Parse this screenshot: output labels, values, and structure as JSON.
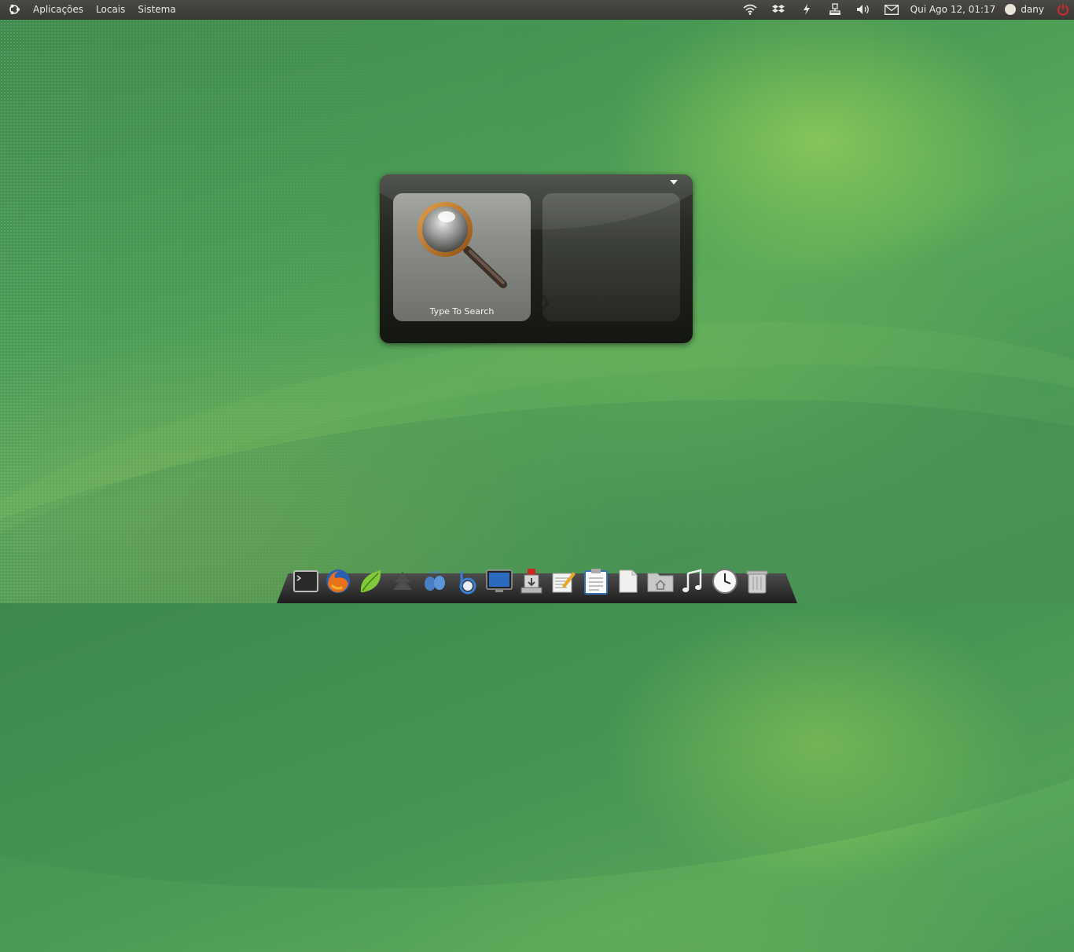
{
  "top_panel": {
    "menus": [
      "Aplicações",
      "Locais",
      "Sistema"
    ],
    "tray_icons": [
      "wifi-icon",
      "dropbox-icon",
      "power-icon",
      "network-icon",
      "volume-icon",
      "mail-icon"
    ],
    "clock": "Qui Ago 12, 01:17",
    "user": "dany",
    "shutdown_icon": "shutdown-icon"
  },
  "launcher": {
    "search_label": "Type To Search",
    "dropdown_icon": "dropdown-arrow-icon"
  },
  "dock": {
    "items": [
      "terminal-icon",
      "firefox-icon",
      "leaf-icon",
      "tree-icon",
      "pidgin-icon",
      "banshee-icon",
      "monitor-icon",
      "usb-creator-icon",
      "text-editor-icon",
      "clipboard-icon",
      "document-icon",
      "home-folder-icon",
      "music-icon",
      "clock-icon",
      "trash-icon"
    ]
  },
  "colors": {
    "panel_bg": "#3a3936",
    "accent_green": "#4a9a55"
  }
}
